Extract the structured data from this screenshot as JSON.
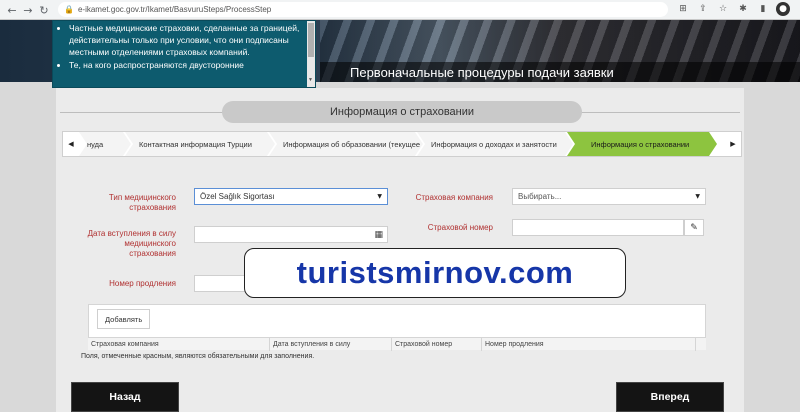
{
  "browser": {
    "url": "e-ikamet.goc.gov.tr/Ikamet/BasvuruSteps/ProcessStep"
  },
  "banner": {
    "caption": "Первоначальные процедуры подачи заявки",
    "info_items": [
      "Частные медицинские страховки, сделанные за границей, действительны только при условии, что они подписаны местными отделениями страховых компаний.",
      "Те, на кого распространяются двусторонние"
    ]
  },
  "section": {
    "title": "Информация о страховании"
  },
  "steps": [
    {
      "label": "нуда"
    },
    {
      "label": "Контактная информация Турции"
    },
    {
      "label": "Информация об образовании (текущее"
    },
    {
      "label": "Информация о доходах и занятости"
    },
    {
      "label": "Информация о страховании"
    }
  ],
  "form": {
    "insurance_type_label": "Тип медицинского страхования",
    "insurance_type_value": "Özel Sağlık Sigortası",
    "start_date_label": "Дата вступления в силу медицинского страхования",
    "start_date_value": "",
    "renewal_label": "Номер продления",
    "renewal_value": "",
    "company_label": "Страховая компания",
    "company_placeholder": "Выбирать...",
    "policy_label": "Страховой номер",
    "policy_value": ""
  },
  "table": {
    "add_button": "Добавлять",
    "headers": [
      "Страховая компания",
      "Дата вступления в силу",
      "Страховой номер",
      "Номер продления"
    ]
  },
  "required_note": "Поля, отмеченные красным, являются обязательными для заполнения.",
  "nav": {
    "back": "Назад",
    "next": "Вперед"
  },
  "watermark": "turistsmirnov.com"
}
